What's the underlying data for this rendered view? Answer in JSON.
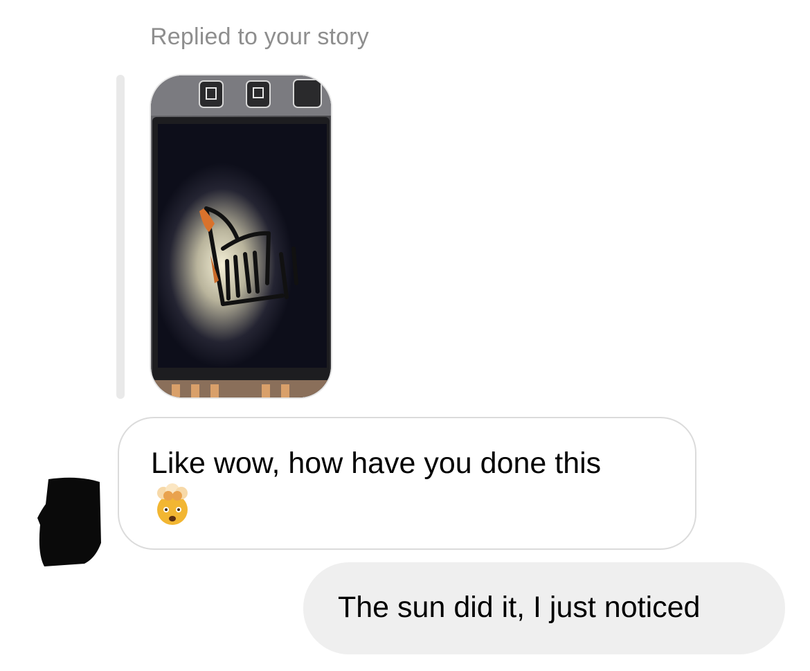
{
  "conversation": {
    "story_reply_label": "Replied to your story",
    "story_thumbnail_icon": "story-photo-thumbnail",
    "messages": [
      {
        "sender": "them",
        "text": "Like wow, how have you done this",
        "emoji": "exploding-head-emoji"
      },
      {
        "sender": "me",
        "text": "The sun did it, I just noticed"
      }
    ]
  },
  "colors": {
    "label_gray": "#8e8e8e",
    "incoming_border": "#dbdbdb",
    "outgoing_bg": "#efefef",
    "quote_bar": "#e9e9e9"
  }
}
